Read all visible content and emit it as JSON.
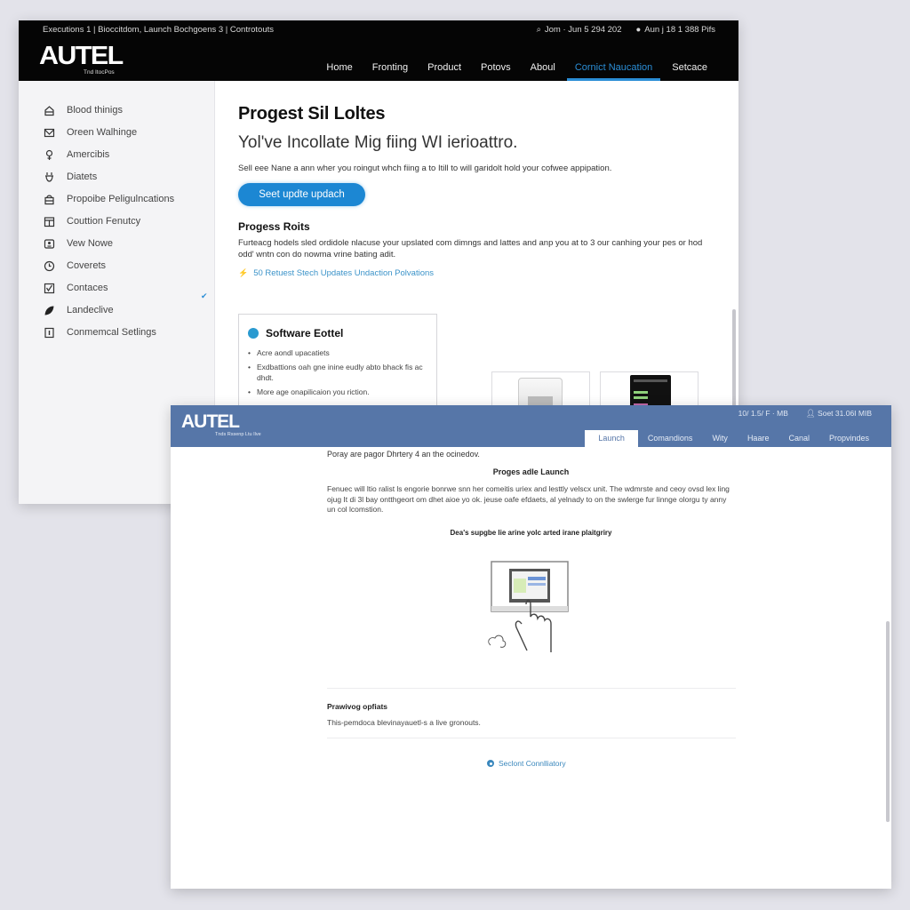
{
  "back_window": {
    "header": {
      "top_links": "Executions 1 | Bioccitdom, Launch Bochgoens 3 | Controtouts",
      "status": [
        {
          "icon": "search-icon",
          "text": "Jom · Jun 5 294 202"
        },
        {
          "icon": "shield-icon",
          "text": "Aun j 18 1 388 Pifs"
        }
      ],
      "logo": "AUTEL",
      "logo_sub": "Tnd ItocPos",
      "nav": [
        {
          "label": "Home",
          "active": false
        },
        {
          "label": "Fronting",
          "active": false
        },
        {
          "label": "Product",
          "active": false
        },
        {
          "label": "Potovs",
          "active": false
        },
        {
          "label": "Aboul",
          "active": false
        },
        {
          "label": "Cornict Naucation",
          "active": true
        },
        {
          "label": "Setcace",
          "active": false
        }
      ]
    },
    "sidebar": {
      "items": [
        {
          "icon": "home-icon",
          "label": "Blood thinigs"
        },
        {
          "icon": "mail-icon",
          "label": "Oreen Walhinge"
        },
        {
          "icon": "help-icon",
          "label": "Amercibis"
        },
        {
          "icon": "plug-icon",
          "label": "Diatets"
        },
        {
          "icon": "bag-icon",
          "label": "Propoibe Peligulncations"
        },
        {
          "icon": "calendar-icon",
          "label": "Couttion Fenutcy"
        },
        {
          "icon": "contact-card-icon",
          "label": "Vew Nowe"
        },
        {
          "icon": "clock-icon",
          "label": "Coverets"
        },
        {
          "icon": "checklist-icon",
          "label": "Contaces"
        },
        {
          "icon": "leaf-icon",
          "label": "Landeclive"
        },
        {
          "icon": "info-icon",
          "label": "Conmemcal Setlings"
        }
      ],
      "checked_index": 6
    },
    "main": {
      "title": "Progest Sil Loltes",
      "subtitle": "Yol've Incollate Mig fiing WI ierioattro.",
      "description": "Sell eee Nane a ann wher you roingut whch fiing a to Itill to will garidolt hold your cofwee appipation.",
      "primary_button": "Seet updte updach",
      "section_title": "Progess Roits",
      "section_text": "Furteacg hodels sled ordidole nlacuse your upslated com dimngs and lattes and anp you at to 3 our canhing your pes or hod odd' wntn con do nowma vrine bating adit.",
      "link": "50 Retuest Stech Updates Undaction Polvations",
      "card": {
        "title": "Software Eottel",
        "bullets": [
          "Acre aondl upacatiets",
          "Exdbattions oah gne inine eudly abto bhack fis ac dhdt.",
          "More age onapilicaion you riction."
        ]
      },
      "thumbnails": [
        {
          "name": "printer-device-image"
        },
        {
          "name": "tablet-device-image"
        }
      ]
    }
  },
  "front_window": {
    "header": {
      "logo": "AUTEL",
      "logo_sub": "Tnds Rssenp Ltu Ilve",
      "status": [
        {
          "text": "10/ 1.5/ F · MB"
        },
        {
          "icon": "user-icon",
          "text": "Soet 31.06I MIB"
        }
      ],
      "nav": [
        {
          "label": "Launch",
          "active": true
        },
        {
          "label": "Comandions",
          "active": false
        },
        {
          "label": "Wity",
          "active": false
        },
        {
          "label": "Haare",
          "active": false
        },
        {
          "label": "Canal",
          "active": false
        },
        {
          "label": "Propvindes",
          "active": false
        }
      ]
    },
    "content": {
      "top_text": "Poray are pagor Dhrtery 4 an the ocinedov.",
      "heading": "Proges adle Launch",
      "paragraph": "Fenuec will ltio ralist ls engorie bonrwe snn her comeitis uriex and lesttly velscx unit. The wdmrste and ceoy ovsd lex ling ojug It di 3l bay ontthgeort om dhet aioe yo ok. jeuse oafe efdaets, al yelnady to on the swlerge fur linnge olorgu ty anny un col lcomstion.",
      "illustration_caption": "Dea's supgbe lie arine yolc arted irane plaitgriry",
      "section_title": "Prawivog opfiats",
      "section_text": "This-pemdoca blevinayauetl-s a live gronouts.",
      "link": "Seclont Connlliatory"
    }
  }
}
